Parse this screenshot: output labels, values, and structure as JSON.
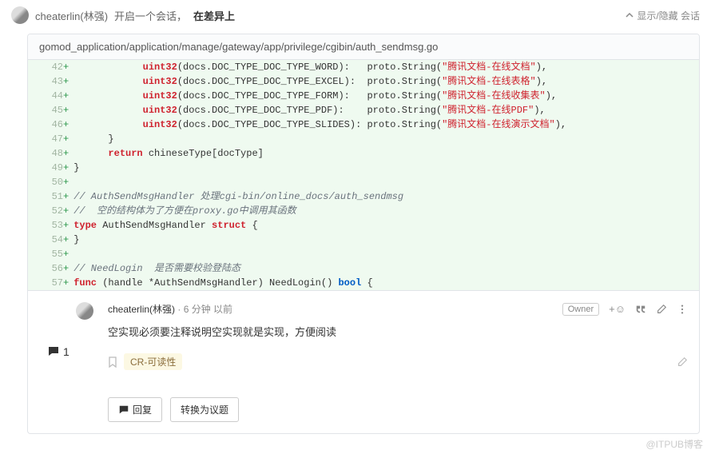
{
  "header": {
    "user": "cheaterlin(林强)",
    "opened": "开启一个会话，",
    "where": "在差异上",
    "toggle": "显示/隐藏 会话"
  },
  "file": {
    "path": "gomod_application/application/manage/gateway/app/privilege/cgibin/auth_sendmsg.go"
  },
  "lines": [
    {
      "n": "42",
      "code": "            <k>uint32</k>(docs.DOC_TYPE_DOC_TYPE_WORD):   proto.String(<s>\"腾讯文档-在线文档\"</s>),"
    },
    {
      "n": "43",
      "code": "            <k>uint32</k>(docs.DOC_TYPE_DOC_TYPE_EXCEL):  proto.String(<s>\"腾讯文档-在线表格\"</s>),"
    },
    {
      "n": "44",
      "code": "            <k>uint32</k>(docs.DOC_TYPE_DOC_TYPE_FORM):   proto.String(<s>\"腾讯文档-在线收集表\"</s>),"
    },
    {
      "n": "45",
      "code": "            <k>uint32</k>(docs.DOC_TYPE_DOC_TYPE_PDF):    proto.String(<s>\"腾讯文档-在线PDF\"</s>),"
    },
    {
      "n": "46",
      "code": "            <k>uint32</k>(docs.DOC_TYPE_DOC_TYPE_SLIDES): proto.String(<s>\"腾讯文档-在线演示文档\"</s>),"
    },
    {
      "n": "47",
      "code": "      }"
    },
    {
      "n": "48",
      "code": "      <k>return</k> chineseType[docType]"
    },
    {
      "n": "49",
      "code": "}"
    },
    {
      "n": "50",
      "code": ""
    },
    {
      "n": "51",
      "code": "<c>// AuthSendMsgHandler 处理cgi-bin/online_docs/auth_sendmsg</c>"
    },
    {
      "n": "52",
      "code": "<c>//  空的结构体为了方便在proxy.go中调用其函数</c>"
    },
    {
      "n": "53",
      "code": "<k>type</k> AuthSendMsgHandler <k>struct</k> {"
    },
    {
      "n": "54",
      "code": "}"
    },
    {
      "n": "55",
      "code": ""
    },
    {
      "n": "56",
      "code": "<c>// NeedLogin  是否需要校验登陆态</c>"
    },
    {
      "n": "57",
      "code": "<k>func</k> (handle *AuthSendMsgHandler) NeedLogin() <b>bool</b> {"
    }
  ],
  "comment": {
    "user": "cheaterlin(林强)",
    "time": "· 6 分钟 以前",
    "owner": "Owner",
    "body": "空实现必须要注释说明空实现就是实现，方便阅读",
    "count": "1",
    "tag": "CR-可读性"
  },
  "footer": {
    "reply": "回复",
    "convert": "转换为议题"
  },
  "watermark": "@ITPUB博客"
}
